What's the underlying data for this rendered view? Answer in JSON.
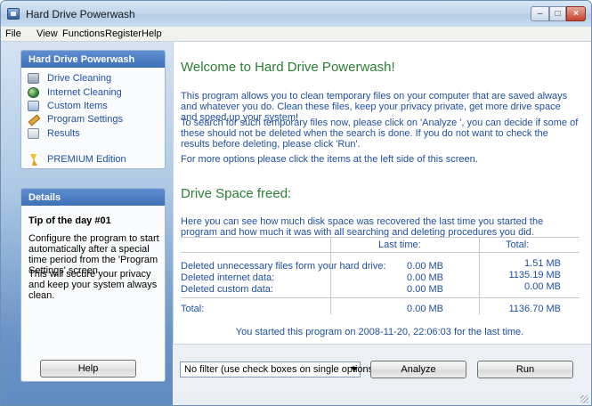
{
  "window": {
    "title": "Hard Drive Powerwash"
  },
  "menu": [
    "File",
    "View",
    "Functions",
    "Register",
    "Help"
  ],
  "nav": {
    "header": "Hard Drive Powerwash",
    "items": [
      {
        "label": "Drive Cleaning",
        "icon": "drive-icon"
      },
      {
        "label": "Internet Cleaning",
        "icon": "globe-icon"
      },
      {
        "label": "Custom Items",
        "icon": "custom-items-icon"
      },
      {
        "label": "Program Settings",
        "icon": "wrench-icon"
      },
      {
        "label": "Results",
        "icon": "results-icon"
      }
    ],
    "premium": {
      "label": "PREMIUM Edition",
      "icon": "lightning-icon"
    }
  },
  "details": {
    "header": "Details",
    "tip_title": "Tip of the day #01",
    "tip_p1": "Configure the program to start automatically after a special time period from the 'Program Settings' screen.",
    "tip_p2": "This will secure your privacy and keep your system always clean."
  },
  "help_button": "Help",
  "content": {
    "welcome_title": "Welcome to Hard Drive Powerwash!",
    "intro": "This program allows you to clean temporary files on your computer that are saved always and whatever you do. Clean these files, keep your privacy private, get more drive space and speed up your system!",
    "search_info": "To search for such temporary files now, please click on 'Analyze ', you can decide if some of these should not be deleted when the search is done. If you do not want to check the results before deleting, please click 'Run'.",
    "more_options": "For more options please click the items at the left side of this screen.",
    "freed_title": "Drive Space freed:",
    "freed_info": "Here you can see how much disk space was recovered the last time you started the program and how much it was with all searching and deleting procedures you did.",
    "stats": {
      "col_last": "Last time:",
      "col_total": "Total:",
      "rows": [
        {
          "label": "Deleted unnecessary files form your hard drive:",
          "last": "0.00 MB",
          "total": "1.51 MB"
        },
        {
          "label": "Deleted internet data:",
          "last": "0.00 MB",
          "total": "1135.19 MB"
        },
        {
          "label": "Deleted custom data:",
          "last": "0.00 MB",
          "total": "0.00 MB"
        }
      ],
      "total_row": {
        "label": "Total:",
        "last": "0.00 MB",
        "total": "1136.70 MB"
      }
    },
    "started": "You started this program on 2008-11-20, 22:06:03 for the last time."
  },
  "bottom": {
    "filter_selected": "No filter (use check boxes on single options windows)",
    "analyze_button": "Analyze",
    "run_button": "Run"
  }
}
